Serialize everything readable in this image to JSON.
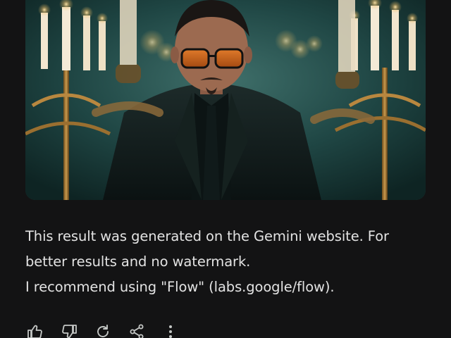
{
  "generated_image": {
    "alt": "Man in dark suit and orange-tinted glasses surrounded by candelabras"
  },
  "response": {
    "lines": [
      "This result was generated on the Gemini website. For",
      "better results and no watermark.",
      "I recommend using \"Flow\" (labs.google/flow)."
    ]
  },
  "actions": [
    {
      "icon": "thumbs-up-icon",
      "label": "Good response"
    },
    {
      "icon": "thumbs-down-icon",
      "label": "Bad response"
    },
    {
      "icon": "redo-icon",
      "label": "Redo"
    },
    {
      "icon": "share-icon",
      "label": "Share"
    },
    {
      "icon": "more-vert-icon",
      "label": "More"
    }
  ],
  "colors": {
    "background": "#131314",
    "text": "#e3e3e3",
    "icon": "#c4c7c5"
  }
}
